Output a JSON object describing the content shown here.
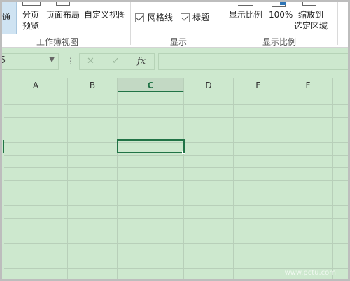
{
  "ribbon": {
    "workbook_views": {
      "normal_label_partial": "通",
      "page_break_line1": "分页",
      "page_break_line2": "预览",
      "page_layout": "页面布局",
      "custom_views": "自定义视图",
      "group_name": "工作簿视图"
    },
    "show": {
      "gridlines": "网格线",
      "gridlines_checked": true,
      "headings": "标题",
      "headings_checked": true,
      "group_name": "显示"
    },
    "zoom": {
      "zoom": "显示比例",
      "hundred": "100%",
      "zoom_selection_line1": "缩放到",
      "zoom_selection_line2": "选定区域",
      "group_name": "显示比例"
    }
  },
  "formula_bar": {
    "cancel_icon": "✕",
    "enter_icon": "✓",
    "function_icon": "fx",
    "namebox_partial": "5",
    "dropdown_icon": "▼",
    "more_icon": "⋮"
  },
  "grid": {
    "columns": [
      "A",
      "B",
      "C",
      "D",
      "E",
      "F"
    ],
    "active_column": "C",
    "watermark": "www.pctu.com"
  },
  "colors": {
    "sheet_background": "#cde8ce",
    "selection": "#217346",
    "ribbon_highlight": "#cfe3f2"
  }
}
